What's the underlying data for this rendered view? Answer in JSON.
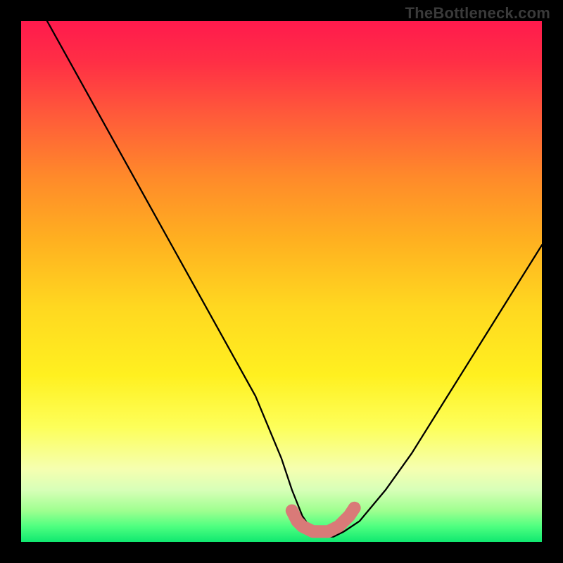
{
  "watermark": "TheBottleneck.com",
  "chart_data": {
    "type": "line",
    "title": "",
    "xlabel": "",
    "ylabel": "",
    "xlim": [
      0,
      100
    ],
    "ylim": [
      0,
      100
    ],
    "series": [
      {
        "name": "bottleneck-curve",
        "x": [
          5,
          10,
          15,
          20,
          25,
          30,
          35,
          40,
          45,
          50,
          52,
          54,
          56,
          58,
          60,
          62,
          65,
          70,
          75,
          80,
          85,
          90,
          95,
          100
        ],
        "y": [
          100,
          91,
          82,
          73,
          64,
          55,
          46,
          37,
          28,
          16,
          10,
          5,
          2,
          1,
          1,
          2,
          4,
          10,
          17,
          25,
          33,
          41,
          49,
          57
        ]
      },
      {
        "name": "optimal-zone-marker",
        "x": [
          52,
          53,
          54,
          55,
          56,
          57,
          58,
          59,
          60,
          61,
          62,
          63,
          64
        ],
        "y": [
          6,
          4,
          3,
          2.5,
          2,
          2,
          2,
          2,
          2.5,
          3,
          4,
          5,
          6.5
        ]
      }
    ],
    "annotations": [],
    "legend": false,
    "grid": false
  }
}
